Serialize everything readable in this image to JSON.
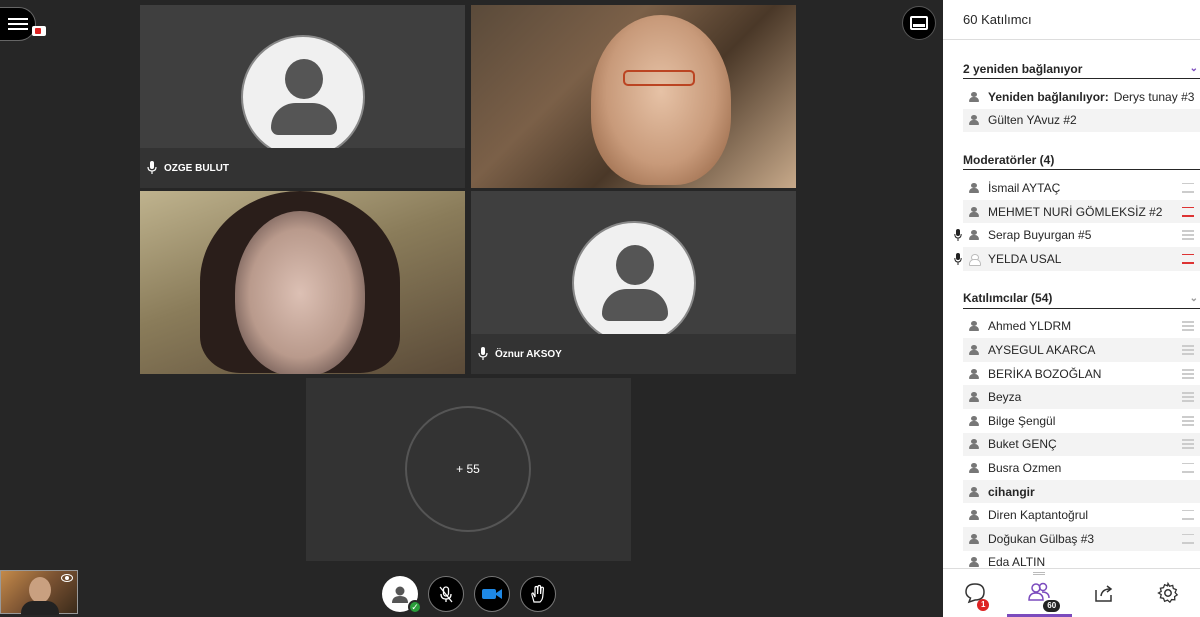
{
  "stage": {
    "tiles": [
      {
        "name": "OZGE BULUT"
      },
      {
        "name": "Öznur AKSOY"
      }
    ],
    "more_count": "+ 55"
  },
  "panel": {
    "header": "60 Katılımcı",
    "reconnecting": {
      "title": "2 yeniden bağlanıyor",
      "rows": [
        {
          "prefix": "Yeniden bağlanılıyor:",
          "name": "Derys tunay #3"
        },
        {
          "prefix": "",
          "name": "Gülten YAvuz #2"
        }
      ]
    },
    "moderators": {
      "title": "Moderatörler (4)",
      "rows": [
        {
          "name": "İsmail AYTAÇ"
        },
        {
          "name": "MEHMET NURİ GÖMLEKSİZ #2"
        },
        {
          "name": "Serap Buyurgan #5"
        },
        {
          "name": "YELDA USAL"
        }
      ]
    },
    "participants": {
      "title": "Katılımcılar (54)",
      "rows": [
        {
          "name": "Ahmed YLDRM"
        },
        {
          "name": "AYSEGUL AKARCA"
        },
        {
          "name": "BERİKA BOZOĞLAN"
        },
        {
          "name": "Beyza"
        },
        {
          "name": "Bilge Şengül"
        },
        {
          "name": "Buket GENÇ"
        },
        {
          "name": "Busra Ozmen"
        },
        {
          "name": "cihangir"
        },
        {
          "name": "Diren Kaptantoğrul"
        },
        {
          "name": "Doğukan Gülbaş #3"
        },
        {
          "name": "Eda ALTIN"
        }
      ]
    },
    "footer": {
      "chat_badge": "1",
      "participants_badge": "60"
    }
  },
  "colors": {
    "accent": "#7b4bbd",
    "alert": "#dd2222",
    "status_ok": "#2a9d3a",
    "camera_active": "#1e88e5"
  }
}
